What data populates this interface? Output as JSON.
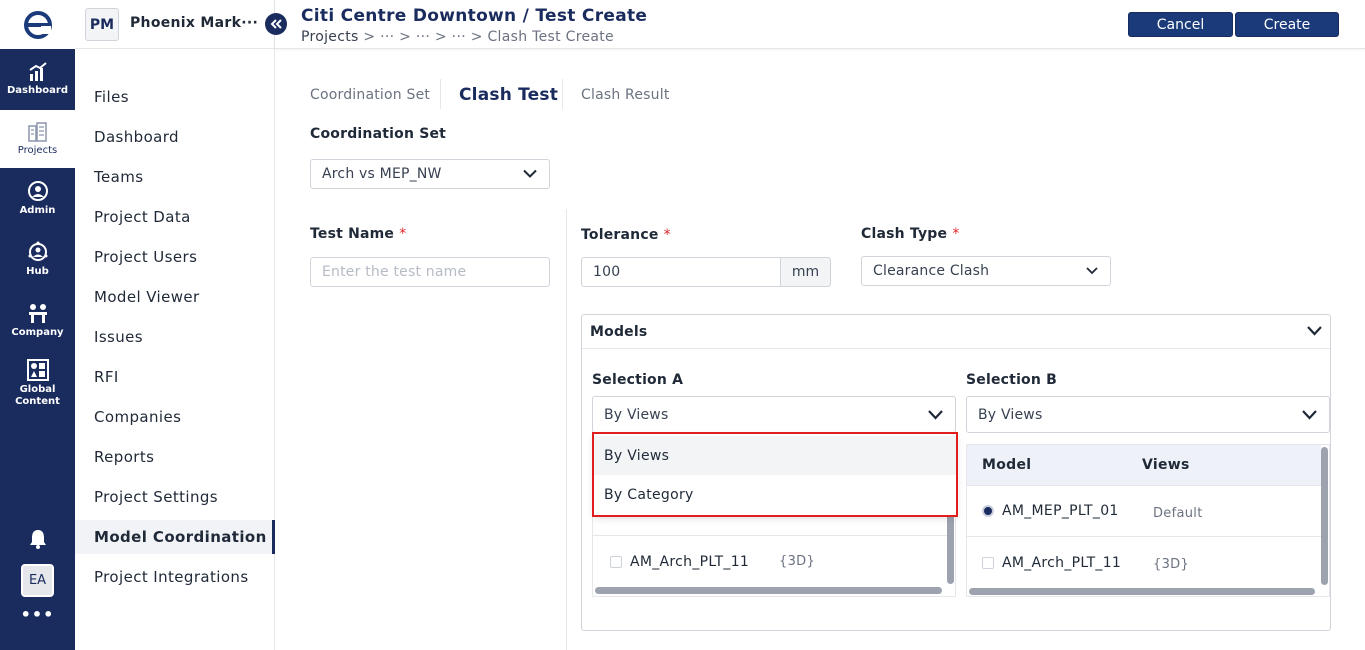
{
  "rail": {
    "items": [
      {
        "label": "Dashboard",
        "icon": "bar-chart-icon"
      },
      {
        "label": "Projects",
        "icon": "buildings-icon"
      },
      {
        "label": "Admin",
        "icon": "user-circle-icon"
      },
      {
        "label": "Hub",
        "icon": "network-icon"
      },
      {
        "label": "Company",
        "icon": "people-desk-icon"
      },
      {
        "label": "Global Content",
        "icon": "shapes-icon"
      }
    ],
    "user_initials": "EA",
    "colors": {
      "background": "#1a2b5e",
      "active_background": "#ffffff"
    }
  },
  "sidebar": {
    "project_badge": "PM",
    "project_name": "Phoenix Mark···",
    "items": [
      {
        "label": "Files"
      },
      {
        "label": "Dashboard"
      },
      {
        "label": "Teams"
      },
      {
        "label": "Project Data"
      },
      {
        "label": "Project Users"
      },
      {
        "label": "Model Viewer"
      },
      {
        "label": "Issues"
      },
      {
        "label": "RFI"
      },
      {
        "label": "Companies"
      },
      {
        "label": "Reports"
      },
      {
        "label": "Project Settings"
      },
      {
        "label": "Model Coordination"
      },
      {
        "label": "Project Integrations"
      }
    ],
    "active_item": "Model Coordination"
  },
  "header": {
    "title": "Citi Centre Downtown / Test Create",
    "breadcrumb": "Projects > ··· > ··· > ··· > Clash Test Create",
    "breadcrumb_first": "Projects",
    "breadcrumb_rest": " > ··· > ··· > ··· > Clash Test Create",
    "cancel_label": "Cancel",
    "create_label": "Create",
    "accent_color": "#1a3a7a"
  },
  "tabs": [
    {
      "label": "Coordination Set",
      "active": false
    },
    {
      "label": "Clash Test",
      "active": true
    },
    {
      "label": "Clash Result",
      "active": false
    }
  ],
  "form": {
    "coordination_set_label": "Coordination Set",
    "coordination_set_value": "Arch vs MEP_NW",
    "test_name_label": "Test Name",
    "test_name_placeholder": "Enter the test name",
    "required_mark": "*",
    "tolerance_label": "Tolerance",
    "tolerance_value": "100",
    "tolerance_unit": "mm",
    "clash_type_label": "Clash Type",
    "clash_type_value": "Clearance Clash"
  },
  "models": {
    "title": "Models",
    "selection_a": {
      "label": "Selection A",
      "value": "By Views",
      "dropdown_open": true,
      "options": [
        "By Views",
        "By Category"
      ],
      "rows": [
        {
          "model": "AM_Arch_PLT_11",
          "view": "{3D}",
          "checked": false
        }
      ]
    },
    "selection_b": {
      "label": "Selection B",
      "value": "By Views",
      "columns": [
        "Model",
        "Views"
      ],
      "rows": [
        {
          "model": "AM_MEP_PLT_01",
          "view": "Default",
          "checked": true
        },
        {
          "model": "AM_Arch_PLT_11",
          "view": "{3D}",
          "checked": false
        }
      ]
    }
  }
}
